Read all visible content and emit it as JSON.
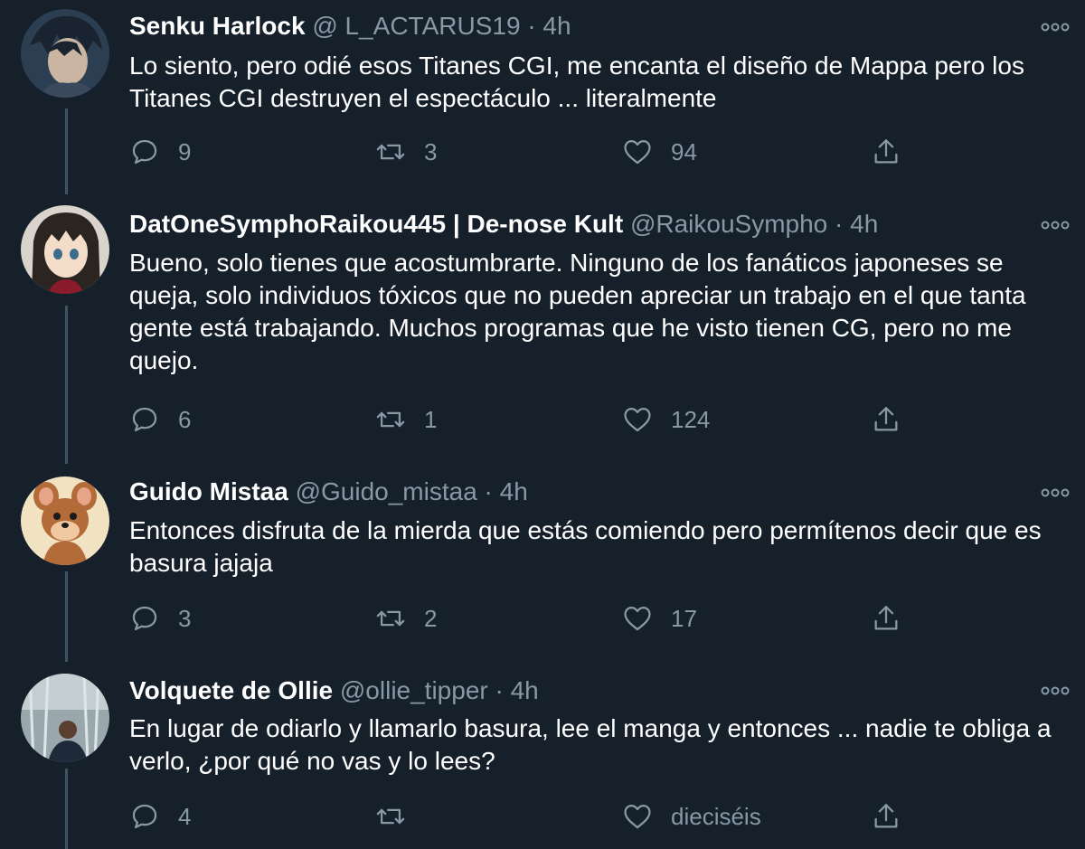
{
  "tweets": [
    {
      "name": "Senku Harlock",
      "handle": "@ L_ACTARUS19",
      "dot": "·",
      "time": "4h",
      "text": "Lo siento, pero odié esos Titanes CGI, me encanta el diseño de Mappa pero los Titanes CGI destruyen el espectáculo ... literalmente",
      "replies": "9",
      "retweets": "3",
      "likes": "94"
    },
    {
      "name": "DatOneSymphoRaikou445 | De-nose Kult",
      "handle": "@RaikouSympho",
      "dot": "·",
      "time": "4h",
      "text": "Bueno, solo tienes que acostumbrarte. Ninguno de los fanáticos japoneses se queja, solo individuos tóxicos que no pueden apreciar un trabajo en el que tanta gente está trabajando. Muchos programas que he visto tienen CG, pero no me quejo.",
      "replies": "6",
      "retweets": "1",
      "likes": "124"
    },
    {
      "name": "Guido Mistaa",
      "handle": "@Guido_mistaa",
      "dot": "·",
      "time": "4h",
      "text": "Entonces disfruta de la mierda que estás comiendo pero permítenos decir que es basura jajaja",
      "replies": "3",
      "retweets": "2",
      "likes": "17"
    },
    {
      "name": "Volquete de Ollie",
      "handle": "@ollie_tipper",
      "dot": "·",
      "time": "4h",
      "text": "En lugar de odiarlo y llamarlo basura, lee el manga y entonces ... nadie te obliga a verlo, ¿por qué no vas y lo lees?",
      "replies": "4",
      "retweets": "",
      "likes": "dieciséis"
    }
  ],
  "icons": {
    "reply": "reply-icon",
    "retweet": "retweet-icon",
    "like": "heart-icon",
    "share": "share-icon",
    "more": "more-options-icon"
  },
  "colors": {
    "background": "#15202b",
    "text": "#ffffff",
    "secondary": "#8899a6",
    "thread_line": "#3d5466"
  }
}
